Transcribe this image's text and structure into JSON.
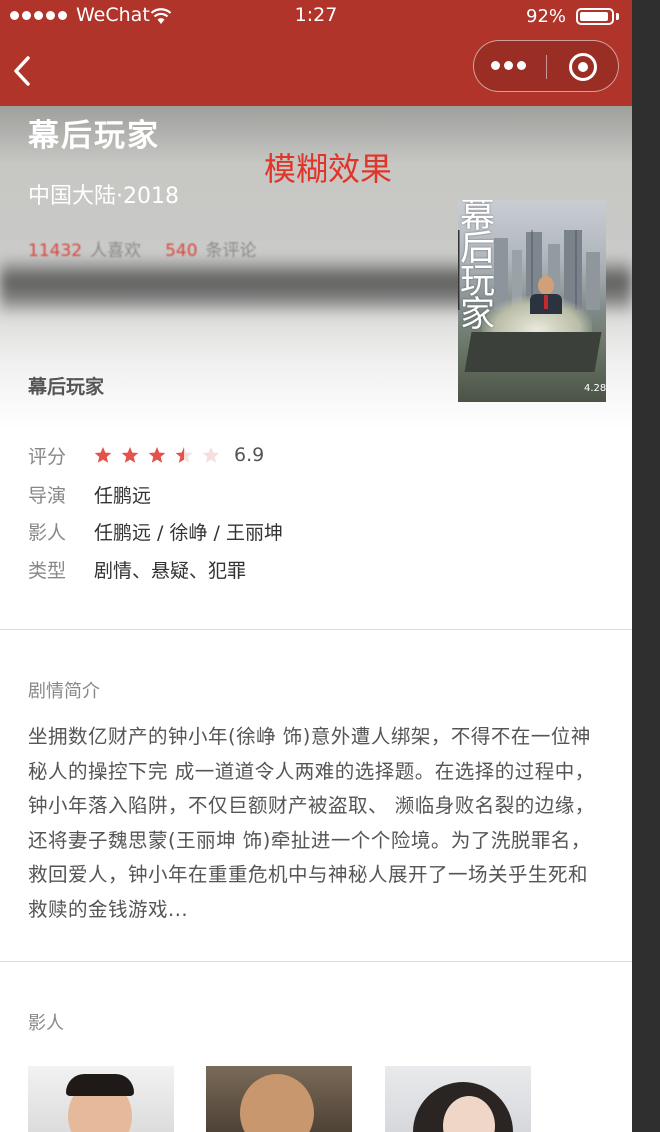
{
  "statusbar": {
    "carrier": "WeChat",
    "time": "1:27",
    "battery": "92%",
    "battery_level": 0.92
  },
  "navbar": {
    "back_icon": "chevron-left-icon",
    "more_icon": "more-dots-icon",
    "close_icon": "target-circle-icon"
  },
  "movie": {
    "title": "幕后玩家",
    "region_year": "中国大陆·2018",
    "overlay_label": "模糊效果",
    "likes_count": "11432",
    "likes_label": "人喜欢",
    "comments_count": "540",
    "comments_label": "条评论",
    "subtitle": "幕后玩家",
    "poster": {
      "title_text": "幕后玩家",
      "date": "4.28"
    }
  },
  "info": {
    "rating_label": "评分",
    "rating_value": "6.9",
    "rating_stars": 3.5,
    "director_label": "导演",
    "director": "任鹏远",
    "cast_label": "影人",
    "cast": "任鹏远 / 徐峥 / 王丽坤",
    "genre_label": "类型",
    "genre": "剧情、悬疑、犯罪"
  },
  "synopsis": {
    "title": "剧情简介",
    "text": "坐拥数亿财产的钟小年(徐峥 饰)意外遭人绑架，不得不在一位神秘人的操控下完 成一道道令人两难的选择题。在选择的过程中，钟小年落入陷阱，不仅巨额财产被盗取、 濒临身败名裂的边缘，还将妻子魏思蒙(王丽坤 饰)牵扯进一个个险境。为了洗脱罪名， 救回爱人，钟小年在重重危机中与神秘人展开了一场关乎生死和救赎的金钱游戏..."
  },
  "cast_section": {
    "title": "影人"
  },
  "colors": {
    "brand": "#b0342a",
    "star": "#e5524a",
    "overlay_label": "#e0362a"
  }
}
